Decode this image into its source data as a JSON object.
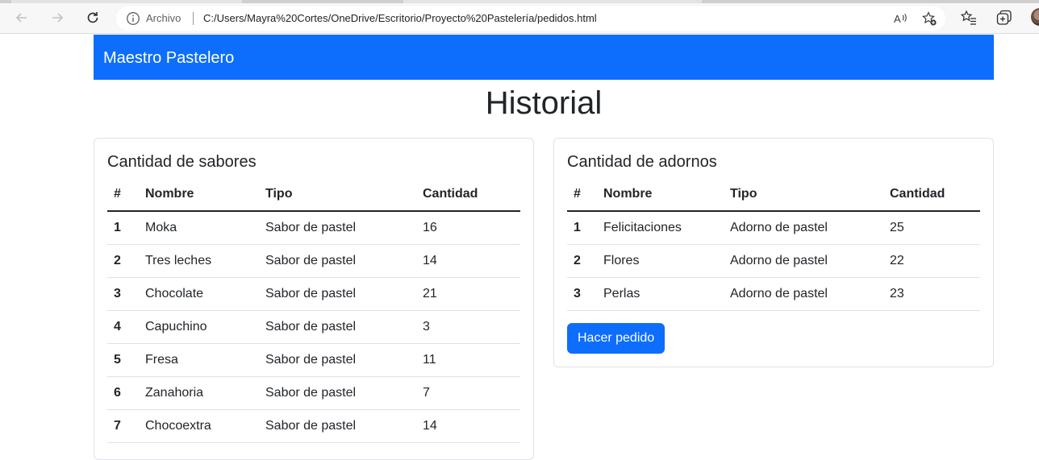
{
  "browser": {
    "address_label": "Archivo",
    "url": "C:/Users/Mayra%20Cortes/OneDrive/Escritorio/Proyecto%20Pastelería/pedidos.html",
    "icons": [
      "back-icon",
      "forward-icon",
      "refresh-icon",
      "info-icon",
      "read-aloud-icon",
      "add-favorite-icon",
      "favorites-icon",
      "collections-icon",
      "profile-avatar"
    ]
  },
  "navbar": {
    "brand": "Maestro Pastelero",
    "color": "#0d6efd"
  },
  "page": {
    "title": "Historial"
  },
  "sabores": {
    "title": "Cantidad de sabores",
    "headers": [
      "#",
      "Nombre",
      "Tipo",
      "Cantidad"
    ],
    "rows": [
      [
        "1",
        "Moka",
        "Sabor de pastel",
        "16"
      ],
      [
        "2",
        "Tres leches",
        "Sabor de pastel",
        "14"
      ],
      [
        "3",
        "Chocolate",
        "Sabor de pastel",
        "21"
      ],
      [
        "4",
        "Capuchino",
        "Sabor de pastel",
        "3"
      ],
      [
        "5",
        "Fresa",
        "Sabor de pastel",
        "11"
      ],
      [
        "6",
        "Zanahoria",
        "Sabor de pastel",
        "7"
      ],
      [
        "7",
        "Chocoextra",
        "Sabor de pastel",
        "14"
      ]
    ]
  },
  "adornos": {
    "title": "Cantidad de adornos",
    "headers": [
      "#",
      "Nombre",
      "Tipo",
      "Cantidad"
    ],
    "rows": [
      [
        "1",
        "Felicitaciones",
        "Adorno de pastel",
        "25"
      ],
      [
        "2",
        "Flores",
        "Adorno de pastel",
        "22"
      ],
      [
        "3",
        "Perlas",
        "Adorno de pastel",
        "23"
      ]
    ],
    "button_label": "Hacer pedido"
  }
}
